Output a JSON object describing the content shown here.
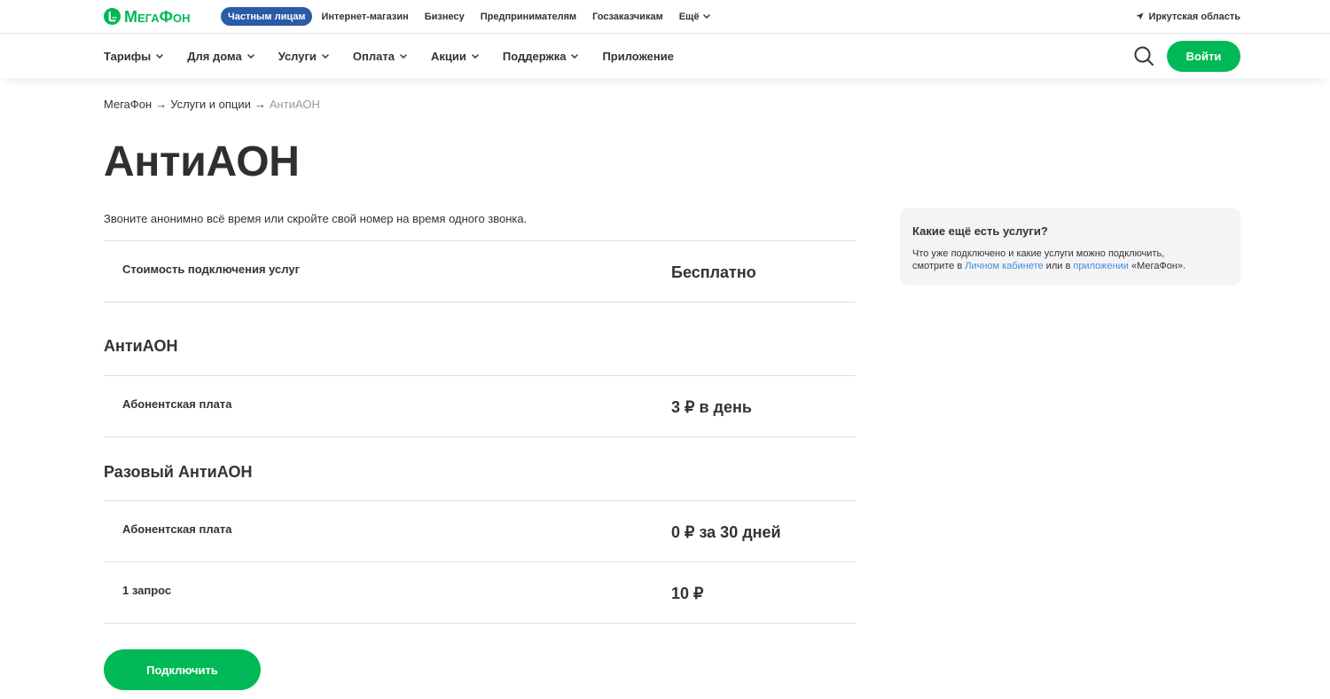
{
  "brand": {
    "logo_text": "МегаФон",
    "accent_color": "#00b956",
    "segment_active_color": "#2b5aa8",
    "link_color": "#3b8fe0"
  },
  "topbar": {
    "segments": [
      "Частным лицам",
      "Интернет-магазин",
      "Бизнесу",
      "Предпринимателям",
      "Госзаказчикам"
    ],
    "active_segment_index": 0,
    "more_label": "Ещё",
    "region": "Иркутская область"
  },
  "nav": {
    "items": [
      {
        "label": "Тарифы",
        "dropdown": true
      },
      {
        "label": "Для дома",
        "dropdown": true
      },
      {
        "label": "Услуги",
        "dropdown": true
      },
      {
        "label": "Оплата",
        "dropdown": true
      },
      {
        "label": "Акции",
        "dropdown": true
      },
      {
        "label": "Поддержка",
        "dropdown": true
      },
      {
        "label": "Приложение",
        "dropdown": false
      }
    ],
    "login_label": "Войти"
  },
  "breadcrumb": {
    "items": [
      "МегаФон",
      "Услуги и опции",
      "АнтиАОН"
    ],
    "separator": "→"
  },
  "page": {
    "title": "АнтиАОН",
    "description": "Звоните анонимно всё время или скройте свой номер на время одного звонка.",
    "connection_cost": {
      "label": "Стоимость подключения услуг",
      "value": "Бесплатно"
    },
    "sections": [
      {
        "title": "АнтиАОН",
        "rows": [
          {
            "label": "Абонентская плата",
            "value": "3 ₽ в день"
          }
        ]
      },
      {
        "title": "Разовый АнтиАОН",
        "rows": [
          {
            "label": "Абонентская плата",
            "value": "0 ₽ за 30 дней"
          },
          {
            "label": "1 запрос",
            "value": "10 ₽"
          }
        ]
      }
    ],
    "connect_button": "Подключить"
  },
  "aside": {
    "title": "Какие ещё есть услуги?",
    "text_line1": "Что уже подключено и какие услуги можно подключить,",
    "text_before_link1": "смотрите в ",
    "link1": "Личном кабинете",
    "text_between": " или в ",
    "link2": "приложении",
    "text_after": " «МегаФон»."
  },
  "icons": {
    "logo": "megafon-logo-icon",
    "location": "location-arrow-icon",
    "dropdown": "chevron-down-icon",
    "search": "search-icon"
  }
}
